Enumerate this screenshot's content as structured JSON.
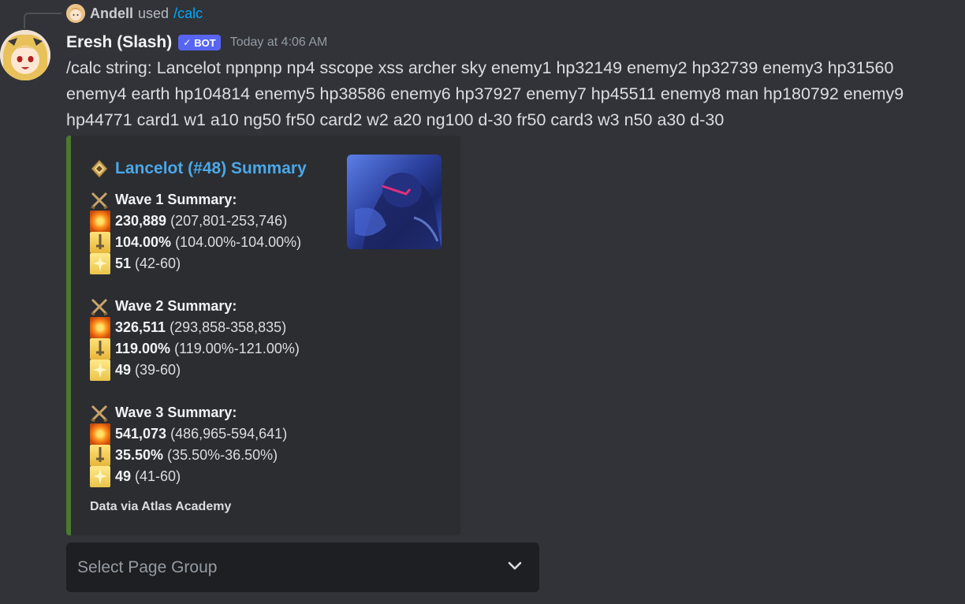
{
  "reply": {
    "username": "Andell",
    "used_text": "used",
    "command": "/calc"
  },
  "message": {
    "username": "Eresh (Slash)",
    "bot_tag": "BOT",
    "timestamp": "Today at 4:06 AM",
    "content": "/calc string: Lancelot npnpnp np4 sscope xss archer sky enemy1 hp32149 enemy2 hp32739 enemy3 hp31560 enemy4 earth hp104814 enemy5 hp38586 enemy6 hp37927 enemy7 hp45511 enemy8 man hp180792 enemy9 hp44771 card1 w1 a10 ng50 fr50 card2 w2 a20 ng100 d-30 fr50 card3 w3 n50 a30 d-30"
  },
  "embed": {
    "accent_color": "#4a7a2f",
    "title": "Lancelot (#48) Summary",
    "title_icon": "berserker-class-icon",
    "waves": [
      {
        "heading": "Wave 1 Summary:",
        "damage": "230,889",
        "damage_range": "(207,801-253,746)",
        "np": "104.00%",
        "np_range": "(104.00%-104.00%)",
        "stars": "51",
        "stars_range": "(42-60)"
      },
      {
        "heading": "Wave 2 Summary:",
        "damage": "326,511",
        "damage_range": "(293,858-358,835)",
        "np": "119.00%",
        "np_range": "(119.00%-121.00%)",
        "stars": "49",
        "stars_range": "(39-60)"
      },
      {
        "heading": "Wave 3 Summary:",
        "damage": "541,073",
        "damage_range": "(486,965-594,641)",
        "np": "35.50%",
        "np_range": "(35.50%-36.50%)",
        "stars": "49",
        "stars_range": "(41-60)"
      }
    ],
    "footer": "Data via Atlas Academy"
  },
  "select": {
    "placeholder": "Select Page Group"
  }
}
